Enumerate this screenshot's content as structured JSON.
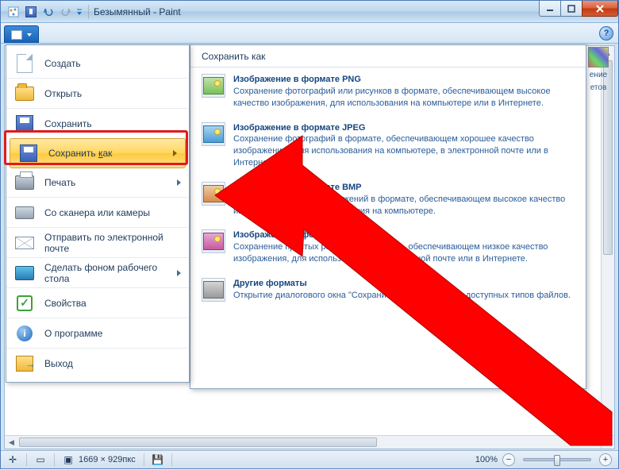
{
  "window": {
    "title": "Безымянный - Paint"
  },
  "file_menu": {
    "items": [
      {
        "label": "Создать",
        "icon": "new",
        "arrow": false
      },
      {
        "label": "Открыть",
        "icon": "open",
        "arrow": false
      },
      {
        "label": "Сохранить",
        "icon": "save",
        "arrow": false
      },
      {
        "label": "Сохранить как",
        "icon": "save",
        "arrow": true,
        "highlight": true,
        "underline_char": "к"
      },
      {
        "label": "Печать",
        "icon": "print",
        "arrow": true
      },
      {
        "label": "Со сканера или камеры",
        "icon": "scan",
        "arrow": false
      },
      {
        "label": "Отправить по электронной почте",
        "icon": "mail",
        "arrow": false
      },
      {
        "label": "Сделать фоном рабочего стола",
        "icon": "desk",
        "arrow": true
      },
      {
        "label": "Свойства",
        "icon": "props",
        "arrow": false
      },
      {
        "label": "О программе",
        "icon": "about",
        "arrow": false
      },
      {
        "label": "Выход",
        "icon": "exit",
        "arrow": false
      }
    ]
  },
  "submenu": {
    "title": "Сохранить как",
    "items": [
      {
        "title": "Изображение в формате PNG",
        "desc": "Сохранение фотографий или рисунков в формате, обеспечивающем высокое качество изображения, для использования на компьютере или в Интернете.",
        "icon": "png"
      },
      {
        "title": "Изображение в формате JPEG",
        "desc": "Сохранение фотографий в формате, обеспечивающем хорошее качество изображения , для использования на компьютере, в электронной почте или в Интернете.",
        "icon": "jpeg"
      },
      {
        "title": "Изображение в формате BMP",
        "desc": "Сохранение любых изображений в формате, обеспечивающем высокое качество изображения, для использования на компьютере.",
        "icon": "bmp"
      },
      {
        "title": "Изображение в формате GIF",
        "desc": "Сохранение простых рисунков в формате, обеспечивающем низкое качество изображения, для использования в электронной почте или в Интернете.",
        "icon": "gif"
      },
      {
        "title": "Другие форматы",
        "desc": "Открытие диалогового окна \"Сохранить как\" для выбора доступных типов файлов.",
        "icon": "other"
      }
    ]
  },
  "ribbon_right": {
    "line1": "ение",
    "line2": "етов"
  },
  "status": {
    "dimensions": "1669 × 929пкс",
    "zoom": "100%"
  }
}
